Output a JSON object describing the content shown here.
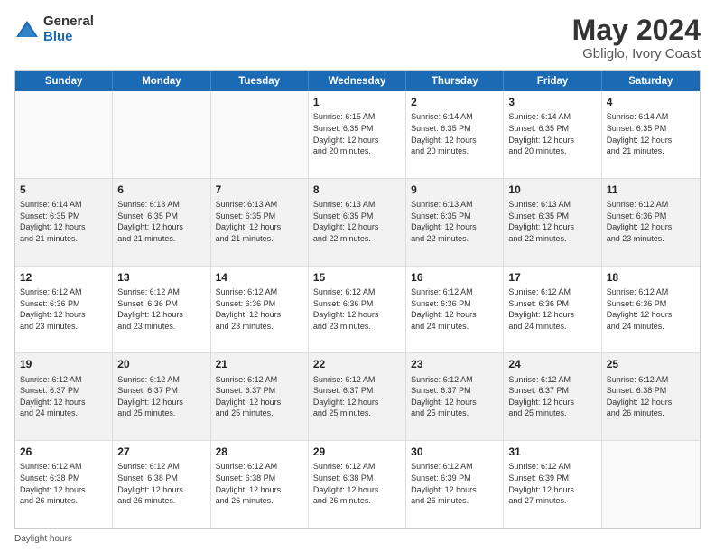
{
  "header": {
    "logo_general": "General",
    "logo_blue": "Blue",
    "title": "May 2024",
    "location": "Gbliglo, Ivory Coast"
  },
  "weekdays": [
    "Sunday",
    "Monday",
    "Tuesday",
    "Wednesday",
    "Thursday",
    "Friday",
    "Saturday"
  ],
  "footer": "Daylight hours",
  "weeks": [
    [
      {
        "day": "",
        "info": ""
      },
      {
        "day": "",
        "info": ""
      },
      {
        "day": "",
        "info": ""
      },
      {
        "day": "1",
        "info": "Sunrise: 6:15 AM\nSunset: 6:35 PM\nDaylight: 12 hours\nand 20 minutes."
      },
      {
        "day": "2",
        "info": "Sunrise: 6:14 AM\nSunset: 6:35 PM\nDaylight: 12 hours\nand 20 minutes."
      },
      {
        "day": "3",
        "info": "Sunrise: 6:14 AM\nSunset: 6:35 PM\nDaylight: 12 hours\nand 20 minutes."
      },
      {
        "day": "4",
        "info": "Sunrise: 6:14 AM\nSunset: 6:35 PM\nDaylight: 12 hours\nand 21 minutes."
      }
    ],
    [
      {
        "day": "5",
        "info": "Sunrise: 6:14 AM\nSunset: 6:35 PM\nDaylight: 12 hours\nand 21 minutes."
      },
      {
        "day": "6",
        "info": "Sunrise: 6:13 AM\nSunset: 6:35 PM\nDaylight: 12 hours\nand 21 minutes."
      },
      {
        "day": "7",
        "info": "Sunrise: 6:13 AM\nSunset: 6:35 PM\nDaylight: 12 hours\nand 21 minutes."
      },
      {
        "day": "8",
        "info": "Sunrise: 6:13 AM\nSunset: 6:35 PM\nDaylight: 12 hours\nand 22 minutes."
      },
      {
        "day": "9",
        "info": "Sunrise: 6:13 AM\nSunset: 6:35 PM\nDaylight: 12 hours\nand 22 minutes."
      },
      {
        "day": "10",
        "info": "Sunrise: 6:13 AM\nSunset: 6:35 PM\nDaylight: 12 hours\nand 22 minutes."
      },
      {
        "day": "11",
        "info": "Sunrise: 6:12 AM\nSunset: 6:36 PM\nDaylight: 12 hours\nand 23 minutes."
      }
    ],
    [
      {
        "day": "12",
        "info": "Sunrise: 6:12 AM\nSunset: 6:36 PM\nDaylight: 12 hours\nand 23 minutes."
      },
      {
        "day": "13",
        "info": "Sunrise: 6:12 AM\nSunset: 6:36 PM\nDaylight: 12 hours\nand 23 minutes."
      },
      {
        "day": "14",
        "info": "Sunrise: 6:12 AM\nSunset: 6:36 PM\nDaylight: 12 hours\nand 23 minutes."
      },
      {
        "day": "15",
        "info": "Sunrise: 6:12 AM\nSunset: 6:36 PM\nDaylight: 12 hours\nand 23 minutes."
      },
      {
        "day": "16",
        "info": "Sunrise: 6:12 AM\nSunset: 6:36 PM\nDaylight: 12 hours\nand 24 minutes."
      },
      {
        "day": "17",
        "info": "Sunrise: 6:12 AM\nSunset: 6:36 PM\nDaylight: 12 hours\nand 24 minutes."
      },
      {
        "day": "18",
        "info": "Sunrise: 6:12 AM\nSunset: 6:36 PM\nDaylight: 12 hours\nand 24 minutes."
      }
    ],
    [
      {
        "day": "19",
        "info": "Sunrise: 6:12 AM\nSunset: 6:37 PM\nDaylight: 12 hours\nand 24 minutes."
      },
      {
        "day": "20",
        "info": "Sunrise: 6:12 AM\nSunset: 6:37 PM\nDaylight: 12 hours\nand 25 minutes."
      },
      {
        "day": "21",
        "info": "Sunrise: 6:12 AM\nSunset: 6:37 PM\nDaylight: 12 hours\nand 25 minutes."
      },
      {
        "day": "22",
        "info": "Sunrise: 6:12 AM\nSunset: 6:37 PM\nDaylight: 12 hours\nand 25 minutes."
      },
      {
        "day": "23",
        "info": "Sunrise: 6:12 AM\nSunset: 6:37 PM\nDaylight: 12 hours\nand 25 minutes."
      },
      {
        "day": "24",
        "info": "Sunrise: 6:12 AM\nSunset: 6:37 PM\nDaylight: 12 hours\nand 25 minutes."
      },
      {
        "day": "25",
        "info": "Sunrise: 6:12 AM\nSunset: 6:38 PM\nDaylight: 12 hours\nand 26 minutes."
      }
    ],
    [
      {
        "day": "26",
        "info": "Sunrise: 6:12 AM\nSunset: 6:38 PM\nDaylight: 12 hours\nand 26 minutes."
      },
      {
        "day": "27",
        "info": "Sunrise: 6:12 AM\nSunset: 6:38 PM\nDaylight: 12 hours\nand 26 minutes."
      },
      {
        "day": "28",
        "info": "Sunrise: 6:12 AM\nSunset: 6:38 PM\nDaylight: 12 hours\nand 26 minutes."
      },
      {
        "day": "29",
        "info": "Sunrise: 6:12 AM\nSunset: 6:38 PM\nDaylight: 12 hours\nand 26 minutes."
      },
      {
        "day": "30",
        "info": "Sunrise: 6:12 AM\nSunset: 6:39 PM\nDaylight: 12 hours\nand 26 minutes."
      },
      {
        "day": "31",
        "info": "Sunrise: 6:12 AM\nSunset: 6:39 PM\nDaylight: 12 hours\nand 27 minutes."
      },
      {
        "day": "",
        "info": ""
      }
    ]
  ]
}
